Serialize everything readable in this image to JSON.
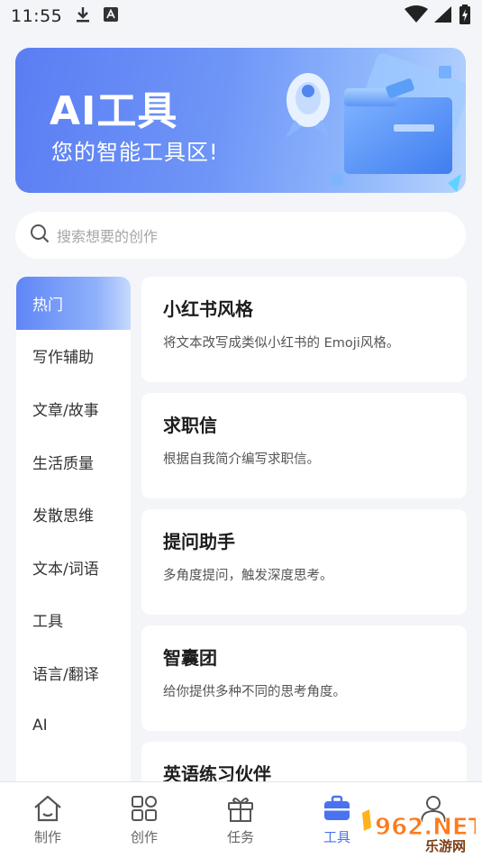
{
  "status_bar": {
    "time": "11:55"
  },
  "banner": {
    "title": "AI工具",
    "subtitle": "您的智能工具区!"
  },
  "search": {
    "placeholder": "搜索想要的创作"
  },
  "sidebar": {
    "items": [
      {
        "label": "热门",
        "active": true
      },
      {
        "label": "写作辅助"
      },
      {
        "label": "文章/故事"
      },
      {
        "label": "生活质量"
      },
      {
        "label": "发散思维"
      },
      {
        "label": "文本/词语"
      },
      {
        "label": "工具"
      },
      {
        "label": "语言/翻译"
      },
      {
        "label": "AI"
      }
    ]
  },
  "cards": [
    {
      "title": "小红书风格",
      "desc": "将文本改写成类似小红书的 Emoji风格。"
    },
    {
      "title": "求职信",
      "desc": "根据自我简介编写求职信。"
    },
    {
      "title": "提问助手",
      "desc": "多角度提问，触发深度思考。"
    },
    {
      "title": "智囊团",
      "desc": "给你提供多种不同的思考角度。"
    },
    {
      "title": "英语练习伙伴",
      "desc": ""
    }
  ],
  "tabbar": {
    "items": [
      {
        "label": "制作",
        "icon": "home-icon"
      },
      {
        "label": "创作",
        "icon": "grid-icon"
      },
      {
        "label": "任务",
        "icon": "gift-icon"
      },
      {
        "label": "工具",
        "icon": "toolbox-icon",
        "active": true
      },
      {
        "label": "",
        "icon": "user-icon"
      }
    ]
  },
  "watermark": {
    "brand": "962.NET",
    "sub": "乐游网"
  },
  "colors": {
    "accent": "#4a72f0",
    "banner_start": "#5b7df3",
    "banner_end": "#b7d4fd"
  }
}
